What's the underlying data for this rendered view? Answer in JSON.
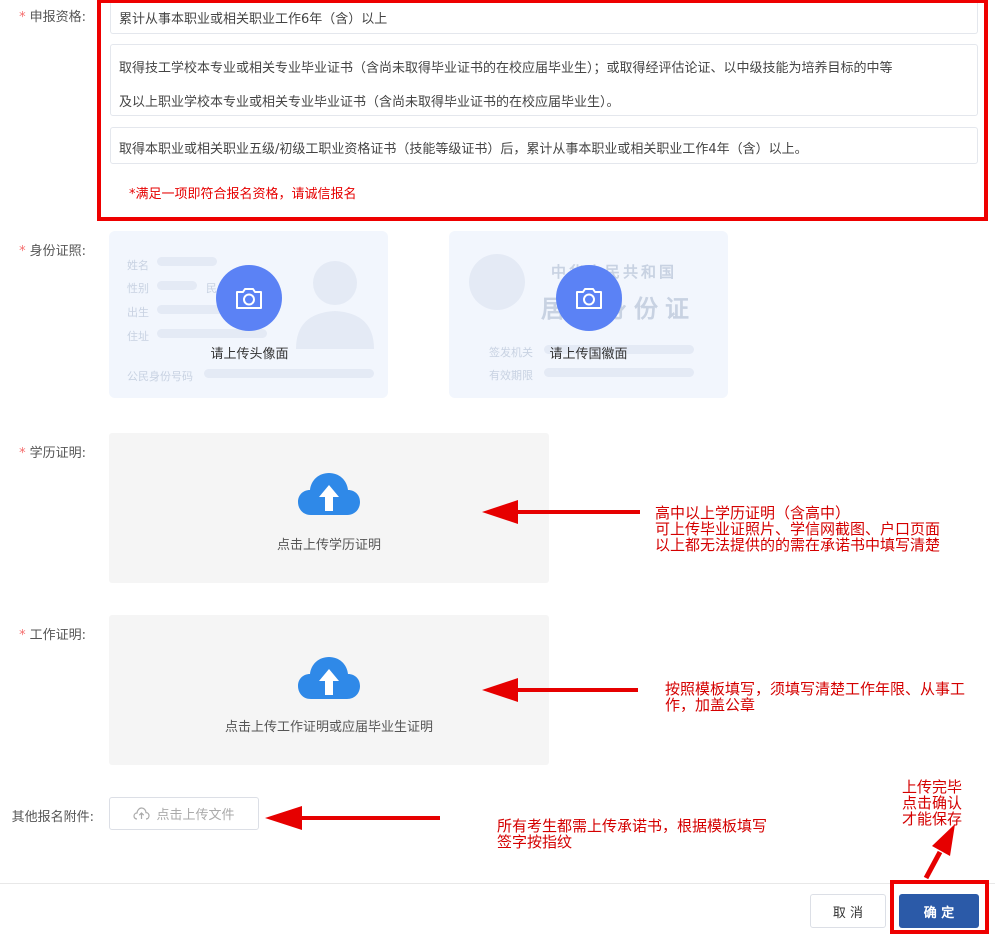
{
  "form": {
    "qualification": {
      "required_mark": "*",
      "label": "申报资格:",
      "options": [
        "累计从事本职业或相关职业工作6年（含）以上",
        "取得技工学校本专业或相关专业毕业证书（含尚未取得毕业证书的在校应届毕业生）；或取得经评估论证、以中级技能为培养目标的中等",
        "及以上职业学校本专业或相关专业毕业证书（含尚未取得毕业证书的在校应届毕业生）。",
        "取得本职业或相关职业五级/初级工职业资格证书（技能等级证书）后，累计从事本职业或相关职业工作4年（含）以上。"
      ],
      "warning": "*满足一项即符合报名资格，请诚信报名"
    },
    "id_card": {
      "required_mark": "*",
      "label": "身份证照:",
      "front": {
        "caption": "请上传头像面",
        "ghost_fields": [
          "姓名",
          "性别",
          "民",
          "出生",
          "住址",
          "公民身份号码"
        ]
      },
      "back": {
        "caption": "请上传国徽面",
        "ghost_title1": "中华人民共和国",
        "ghost_title2": "居民身份证",
        "ghost_fields": [
          "签发机关",
          "有效期限"
        ]
      }
    },
    "education": {
      "required_mark": "*",
      "label": "学历证明:",
      "caption": "点击上传学历证明"
    },
    "work": {
      "required_mark": "*",
      "label": "工作证明:",
      "caption": "点击上传工作证明或应届毕业生证明"
    },
    "attachment": {
      "label": "其他报名附件:",
      "button": "点击上传文件"
    }
  },
  "footer": {
    "cancel": "取 消",
    "confirm": "确 定"
  },
  "annotations": {
    "education_note": [
      "高中以上学历证明（含高中）",
      "可上传毕业证照片、学信网截图、户口页面",
      "以上都无法提供的的需在承诺书中填写清楚"
    ],
    "work_note": [
      "按照模板填写，须填写清楚工作年限、从事工",
      "作，加盖公章"
    ],
    "attachment_note": [
      "所有考生都需上传承诺书，根据模板填写",
      "签字按指纹"
    ],
    "confirm_note": [
      "上传完毕",
      "点击确认",
      "才能保存"
    ]
  },
  "colors": {
    "required": "#f56c6c",
    "annotation_red": "#e60000",
    "camera_button": "#5b82f5",
    "cloud_icon": "#2f89e8",
    "confirm_button": "#2b5aa8"
  }
}
